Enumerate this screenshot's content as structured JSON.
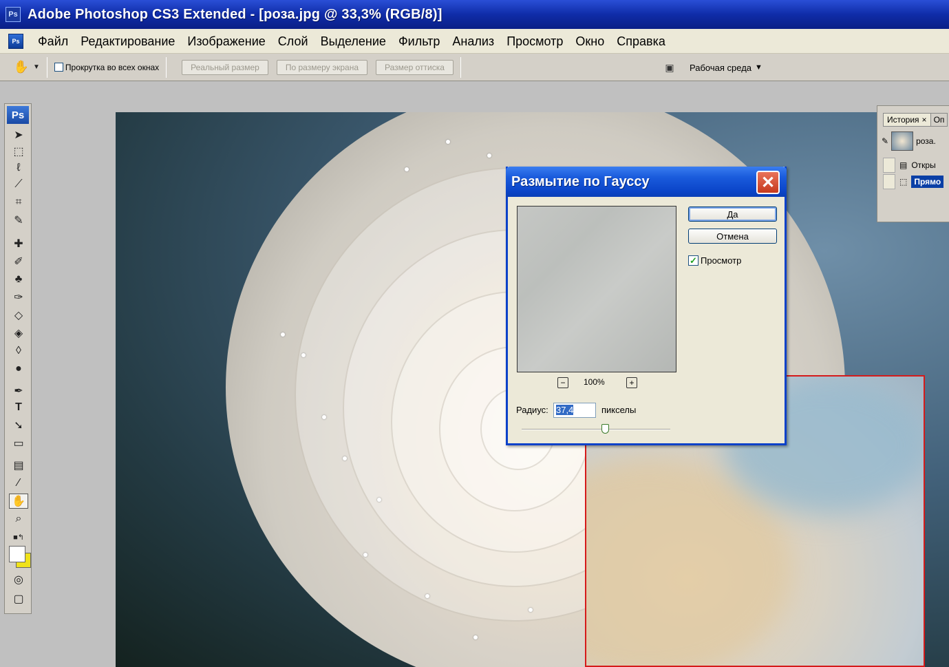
{
  "window": {
    "title": "Adobe Photoshop CS3 Extended - [роза.jpg @ 33,3% (RGB/8)]",
    "badge": "Ps"
  },
  "menubar": {
    "app_icon": "Ps",
    "items": [
      "Файл",
      "Редактирование",
      "Изображение",
      "Слой",
      "Выделение",
      "Фильтр",
      "Анализ",
      "Просмотр",
      "Окно",
      "Справка"
    ]
  },
  "options": {
    "scroll_all_label": "Прокрутка во всех окнах",
    "actual_size": "Реальный размер",
    "fit_screen": "По размеру экрана",
    "print_size": "Размер оттиска",
    "workspace_label": "Рабочая среда"
  },
  "toolbox": {
    "logo": "Ps",
    "icons": [
      "move-icon",
      "marquee-icon",
      "lasso-icon",
      "magic-wand-icon",
      "crop-icon",
      "slice-icon",
      "healing-brush-icon",
      "brush-icon",
      "clone-stamp-icon",
      "history-brush-icon",
      "eraser-icon",
      "paint-bucket-icon",
      "blur-icon",
      "dodge-icon",
      "pen-icon",
      "type-icon",
      "path-selection-icon",
      "shape-icon",
      "notes-icon",
      "eyedropper-icon",
      "hand-icon",
      "zoom-icon"
    ],
    "foreground_color": "#ffffff",
    "background_color": "#f0e21a"
  },
  "history": {
    "tab_label": "История",
    "tab_close": "×",
    "tab2_label": "Оп",
    "snapshot_label": "роза.",
    "rows": [
      "Откры",
      "Прямо"
    ]
  },
  "dialog": {
    "title": "Размытие по Гауссу",
    "ok": "Да",
    "cancel": "Отмена",
    "preview_label": "Просмотр",
    "zoom": "100%",
    "radius_label": "Радиус:",
    "radius_value": "37,4",
    "units": "пикселы"
  }
}
